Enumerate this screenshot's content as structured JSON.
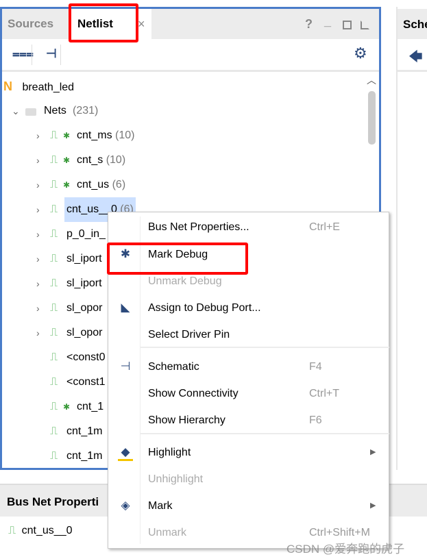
{
  "left_panel": {
    "tabs": [
      {
        "label": "Sources"
      },
      {
        "label": "Netlist"
      }
    ],
    "close": "×",
    "help": "?",
    "minimize": "_",
    "tree": {
      "root": "breath_led",
      "root_icon": "N",
      "nets": {
        "label": "Nets",
        "count": "(231)"
      },
      "items": [
        {
          "label": "cnt_ms",
          "count": "(10)",
          "debug": true,
          "expandable": true
        },
        {
          "label": "cnt_s",
          "count": "(10)",
          "debug": true,
          "expandable": true
        },
        {
          "label": "cnt_us",
          "count": "(6)",
          "debug": true,
          "expandable": true
        },
        {
          "label": "cnt_us__0",
          "count": "(6)",
          "debug": false,
          "expandable": true,
          "selected": true
        },
        {
          "label": "p_0_in_",
          "count": "",
          "debug": false,
          "expandable": true
        },
        {
          "label": "sl_iport",
          "count": "",
          "debug": false,
          "expandable": true
        },
        {
          "label": "sl_iport",
          "count": "",
          "debug": false,
          "expandable": true
        },
        {
          "label": "sl_opor",
          "count": "",
          "debug": false,
          "expandable": true
        },
        {
          "label": "sl_opor",
          "count": "",
          "debug": false,
          "expandable": true
        },
        {
          "label": "<const0",
          "count": "",
          "debug": false,
          "expandable": false
        },
        {
          "label": "<const1",
          "count": "",
          "debug": false,
          "expandable": false
        },
        {
          "label": "cnt_1",
          "count": "",
          "debug": true,
          "expandable": false
        },
        {
          "label": "cnt_1m",
          "count": "",
          "debug": false,
          "expandable": false
        },
        {
          "label": "cnt_1m",
          "count": "",
          "debug": false,
          "expandable": false
        }
      ]
    }
  },
  "right_panel": {
    "tab": "Sche"
  },
  "bottom_panel": {
    "title": "Bus Net Properti",
    "net": "cnt_us__0"
  },
  "context_menu": {
    "items": [
      {
        "label": "Bus Net Properties...",
        "shortcut": "Ctrl+E",
        "icon": "",
        "disabled": false
      },
      {
        "label": "Mark Debug",
        "shortcut": "",
        "icon": "bug-icon",
        "disabled": false
      },
      {
        "label": "Unmark Debug",
        "shortcut": "",
        "icon": "",
        "disabled": true
      },
      {
        "label": "Assign to Debug Port...",
        "shortcut": "",
        "icon": "debug-port-icon",
        "disabled": false
      },
      {
        "label": "Select Driver Pin",
        "shortcut": "",
        "icon": "",
        "disabled": false
      },
      {
        "label": "Schematic",
        "shortcut": "F4",
        "icon": "schematic-icon",
        "disabled": false
      },
      {
        "label": "Show Connectivity",
        "shortcut": "Ctrl+T",
        "icon": "",
        "disabled": false
      },
      {
        "label": "Show Hierarchy",
        "shortcut": "F6",
        "icon": "",
        "disabled": false
      },
      {
        "label": "Highlight",
        "shortcut": "",
        "icon": "highlight-icon",
        "disabled": false,
        "submenu": true
      },
      {
        "label": "Unhighlight",
        "shortcut": "",
        "icon": "",
        "disabled": true
      },
      {
        "label": "Mark",
        "shortcut": "",
        "icon": "mark-icon",
        "disabled": false,
        "submenu": true
      },
      {
        "label": "Unmark",
        "shortcut": "Ctrl+Shift+M",
        "icon": "",
        "disabled": true
      }
    ]
  },
  "watermark": "CSDN @爱奔跑的虎子",
  "colors": {
    "accent": "#4a7cc9",
    "highlight_box": "#ff0000",
    "selection": "#cce0ff",
    "net_icon": "#4caf50"
  }
}
